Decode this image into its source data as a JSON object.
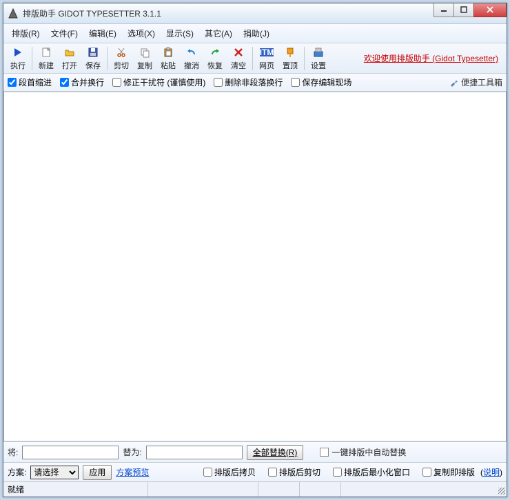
{
  "title": "排版助手 GIDOT TYPESETTER 3.1.1",
  "menus": [
    "排版(R)",
    "文件(F)",
    "编辑(E)",
    "选项(X)",
    "显示(S)",
    "其它(A)",
    "捐助(J)"
  ],
  "toolbar": {
    "execute": "执行",
    "new": "新建",
    "open": "打开",
    "save": "保存",
    "cut": "剪切",
    "copy": "复制",
    "paste": "粘贴",
    "undo": "撤消",
    "redo": "恢复",
    "clear": "清空",
    "html": "网页",
    "top": "置顶",
    "settings": "设置"
  },
  "welcome": "欢迎使用排版助手 (Gidot Typesetter)",
  "options": {
    "indent": "段首缩进",
    "merge_newline": "合并换行",
    "fix_disturbance": "修正干扰符 (谨慎使用)",
    "remove_nonpara": "删除非段落换行",
    "save_edit_scene": "保存编辑现场",
    "toolbox": "便捷工具箱"
  },
  "replace": {
    "from_label": "将:",
    "to_label": "替为:",
    "replace_all_btn": "全部替换(R)",
    "auto_replace_chk": "一键排版中自动替换"
  },
  "scheme": {
    "label": "方案:",
    "select_placeholder": "请选择",
    "apply_btn": "应用",
    "preview_link": "方案预览",
    "copy_after": "排版后拷贝",
    "cut_after": "排版后剪切",
    "minimize_after": "排版后最小化窗口",
    "copy_then_typeset": "复制即排版",
    "explain": "说明"
  },
  "status": "就绪"
}
